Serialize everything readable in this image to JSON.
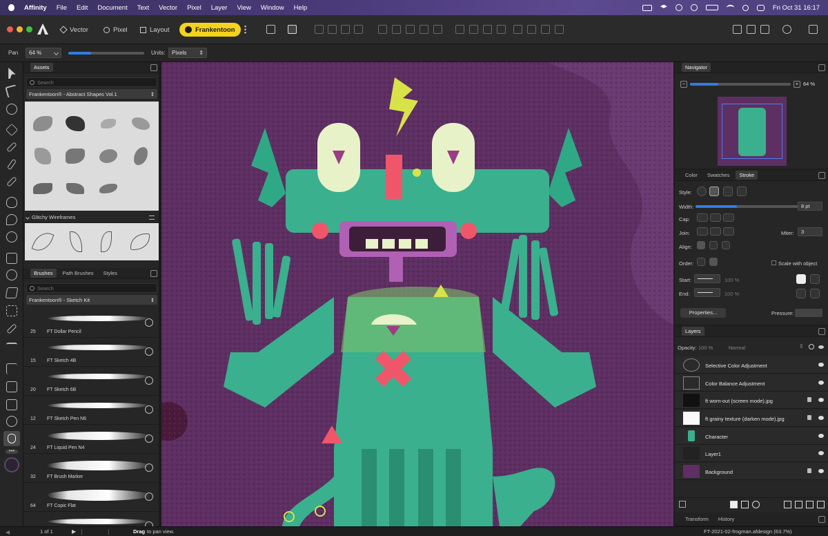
{
  "menubar": {
    "apple": "",
    "app": "Affinity",
    "items": [
      "File",
      "Edit",
      "Document",
      "Text",
      "Vector",
      "Pixel",
      "Layer",
      "View",
      "Window",
      "Help"
    ],
    "clock": "Fri Oct 31  16:17"
  },
  "toolbar": {
    "personas": [
      "Vector",
      "Pixel",
      "Layout",
      "Frankentoon"
    ],
    "active_persona": "Frankentoon"
  },
  "context": {
    "tool": "Pan",
    "zoom": "64 %",
    "zoom_fraction": 0.3,
    "units_label": "Units:",
    "units_value": "Pixels"
  },
  "assets": {
    "tab": "Assets",
    "search_placeholder": "Search",
    "collection": "Frankentoon® - Abstract Shapes Vol.1",
    "subcategory": "Glitchy Wireframes"
  },
  "brushes": {
    "tabs": [
      "Brushes",
      "Path Brushes",
      "Styles"
    ],
    "search_placeholder": "Search",
    "collection": "Frankentoon® - Sketch Kit",
    "items": [
      {
        "size": "25",
        "name": "FT Dollar Pencil"
      },
      {
        "size": "15",
        "name": "FT Sketch 4B"
      },
      {
        "size": "20",
        "name": "FT Sketch 6B"
      },
      {
        "size": "12",
        "name": "FT Sketch Pen N6"
      },
      {
        "size": "24",
        "name": "FT Liquid Pen N4"
      },
      {
        "size": "32",
        "name": "FT Brush Marker"
      },
      {
        "size": "64",
        "name": "FT Copic Flat"
      }
    ]
  },
  "navigator": {
    "title": "Navigator",
    "zoom": "64 %",
    "zoom_fraction": 0.28
  },
  "stroke": {
    "tabs": [
      "Color",
      "Swatches",
      "Stroke"
    ],
    "style_label": "Style:",
    "width_label": "Width:",
    "width_value": "8 pt",
    "width_fraction": 0.4,
    "cap_label": "Cap:",
    "join_label": "Join:",
    "miter_label": "Miter:",
    "miter_value": "3",
    "align_label": "Align:",
    "order_label": "Order:",
    "scale_label": "Scale with object",
    "start_label": "Start:",
    "end_label": "End:",
    "start_pct": "100 %",
    "end_pct": "100 %",
    "properties_label": "Properties...",
    "pressure_label": "Pressure:"
  },
  "layers": {
    "title": "Layers",
    "opacity_label": "Opacity:",
    "opacity_value": "100 %",
    "blend": "Normal",
    "items": [
      {
        "name": "Selective Color Adjustment",
        "locked": false
      },
      {
        "name": "Color Balance Adjustment",
        "locked": false
      },
      {
        "name": "ft worn-out (screen mode).jpg",
        "locked": true
      },
      {
        "name": "ft grainy texture (darken mode).jpg",
        "locked": true
      },
      {
        "name": "Character",
        "locked": false
      },
      {
        "name": "Layer1",
        "locked": false
      },
      {
        "name": "Background",
        "locked": true
      }
    ]
  },
  "bottom_tabs": [
    "Transform",
    "History"
  ],
  "status": {
    "page": "1 of 1",
    "hint_bold": "Drag",
    "hint": "to pan view.",
    "file": "FT-2021-02-frogman.afdesign (63.7%)"
  },
  "colors": {
    "accent": "#2f7de1",
    "persona_active": "#f5d21b",
    "canvas_bg": "#5e2f62",
    "character_green": "#2fa886"
  }
}
